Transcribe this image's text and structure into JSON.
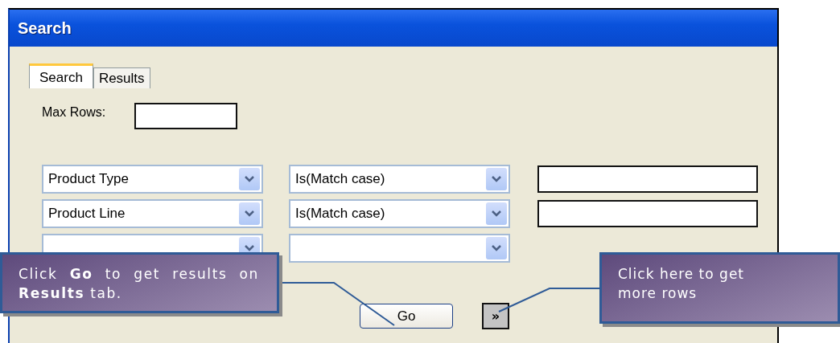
{
  "window": {
    "title": "Search"
  },
  "tabs": [
    {
      "label": "Search",
      "selected": true
    },
    {
      "label": "Results",
      "selected": false
    }
  ],
  "max_rows": {
    "label": "Max Rows:"
  },
  "criteria": [
    {
      "field": "Product Type",
      "operator": "Is(Match case)",
      "value_box": true
    },
    {
      "field": "Product Line",
      "operator": "Is(Match case)",
      "value_box": true
    },
    {
      "value_box": false
    }
  ],
  "buttons": {
    "go": "Go",
    "more": "»"
  },
  "callouts": [
    {
      "text": "Click **Go** to get results on **Results** tab."
    },
    {
      "text": "Click here to get more rows"
    }
  ]
}
